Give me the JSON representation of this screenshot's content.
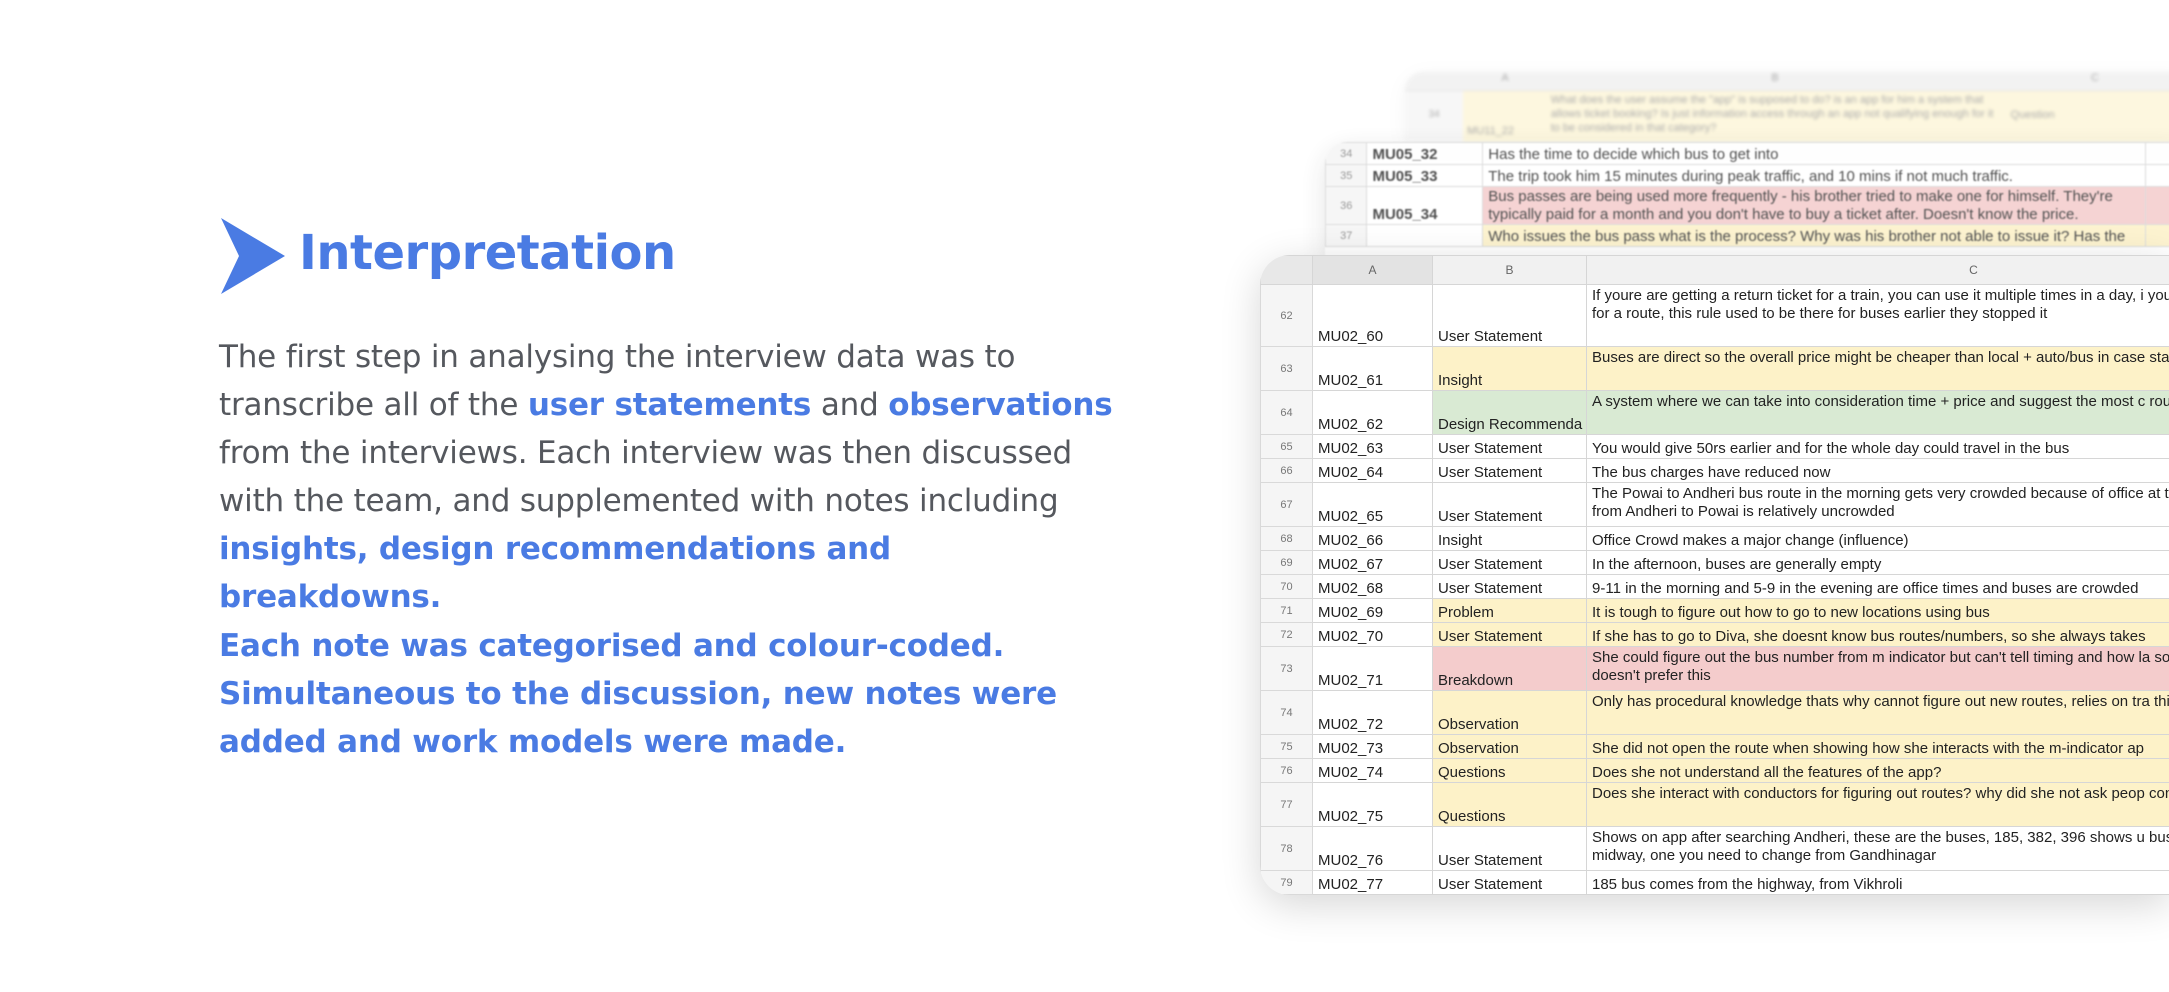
{
  "heading": {
    "title": "Interpretation",
    "accent_color": "#4a7be3",
    "icon": "play-arrow-icon"
  },
  "paragraph1": {
    "text_a": "The first step in analysing the interview data was to transcribe all of the ",
    "hl_user_statements": "user statements",
    "text_and": " and ",
    "hl_observations": "observations",
    "text_b": " from the interviews. Each interview was then discussed with the team, and supplemented with notes including ",
    "hl_insights": "insights, design recommendations and breakdowns."
  },
  "paragraph2": {
    "text": "Each note was categorised and colour-coded. Simultaneous to the discussion, new notes were added and work models were made."
  },
  "back_sheet_2": {
    "row_number": "34",
    "id": "MU11_22",
    "text": "What does the user assume the \"app\" is supposed to do? is an app for him a system that allows ticket booking? Is just information access through an app not qualifying enough for it to be considered in that category?",
    "category": "Question"
  },
  "back_sheet_1": {
    "rows": [
      {
        "row": "34",
        "id": "MU05_32",
        "text": "Has the time to decide which bus to get into",
        "color": ""
      },
      {
        "row": "35",
        "id": "MU05_33",
        "text": "The trip took him 15 minutes during peak traffic, and 10 mins if not much traffic.",
        "color": ""
      },
      {
        "row": "36",
        "id": "MU05_34",
        "text": "Bus passes are being used more frequently - his brother tried to make one for himself. They're typically paid for a month and you don't have to buy a ticket after. Doesn't know the price.",
        "color": "red"
      },
      {
        "row": "37",
        "id": "",
        "text": "Who issues the bus pass what is the process? Why was his brother not able to issue it? Has the",
        "color": "yellow"
      }
    ]
  },
  "main_sheet": {
    "columns": [
      "A",
      "B",
      "C"
    ],
    "colors": {
      "yellow": "#fdf2c8",
      "green": "#d9ead3",
      "red": "#f4cccc"
    },
    "rows": [
      {
        "row": "62",
        "id": "MU02_60",
        "category": "User Statement",
        "text": "If youre are getting a return ticket for a train, you can use it multiple times in a day, i you can only get a ticket once for a route, this rule used to be there for buses earlier they stopped it",
        "color": ""
      },
      {
        "row": "63",
        "id": "MU02_61",
        "category": "Insight",
        "text": "Buses are direct so the overall price might be cheaper than local + auto/bus in case station is far",
        "color": "yellow"
      },
      {
        "row": "64",
        "id": "MU02_62",
        "category": "Design Recommenda",
        "text": "A system where we can take into consideration time + price and suggest the most c route for travelling",
        "color": "green"
      },
      {
        "row": "65",
        "id": "MU02_63",
        "category": "User Statement",
        "text": "You would give 50rs earlier and for the whole day could travel in the bus",
        "color": ""
      },
      {
        "row": "66",
        "id": "MU02_64",
        "category": "User Statement",
        "text": "The bus charges have reduced now",
        "color": ""
      },
      {
        "row": "67",
        "id": "MU02_65",
        "category": "User Statement",
        "text": "The Powai to Andheri bus route in the morning gets very crowded because of office at the same time the route from Andheri to Powai is relatively uncrowded",
        "color": ""
      },
      {
        "row": "68",
        "id": "MU02_66",
        "category": "Insight",
        "text": "Office Crowd makes a major change (influence)",
        "color": ""
      },
      {
        "row": "69",
        "id": "MU02_67",
        "category": "User Statement",
        "text": "In the afternoon, buses are generally empty",
        "color": ""
      },
      {
        "row": "70",
        "id": "MU02_68",
        "category": "User Statement",
        "text": "9-11 in the morning and 5-9 in the evening are office times and buses are crowded",
        "color": ""
      },
      {
        "row": "71",
        "id": "MU02_69",
        "category": "Problem",
        "text": "It is tough to figure out how to go to new locations using bus",
        "color": "yellow"
      },
      {
        "row": "72",
        "id": "MU02_70",
        "category": "User Statement",
        "text": "If she has to go to Diva, she doesnt know bus routes/numbers, so she always takes",
        "color": "yellow"
      },
      {
        "row": "73",
        "id": "MU02_71",
        "category": "Breakdown",
        "text": "She could figure out the bus number from m indicator but can't tell timing and how la so she has to wait and doesn't prefer this",
        "color": "red"
      },
      {
        "row": "74",
        "id": "MU02_72",
        "category": "Observation",
        "text": "Only has procedural knowledge thats why cannot figure out new routes, relies on tra this case",
        "color": "yellow"
      },
      {
        "row": "75",
        "id": "MU02_73",
        "category": "Observation",
        "text": "She did not open the route when showing how she interacts with the m-indicator ap",
        "color": "yellow"
      },
      {
        "row": "76",
        "id": "MU02_74",
        "category": "Questions",
        "text": "Does she not understand all the features of the app?",
        "color": "yellow"
      },
      {
        "row": "77",
        "id": "MU02_75",
        "category": "Questions",
        "text": "Does she interact with conductors for figuring out routes? why did she not ask peop conductor about new route",
        "color": "yellow"
      },
      {
        "row": "78",
        "id": "MU02_76",
        "category": "User Statement",
        "text": "Shows on app after searching Andheri, these are the buses, 185, 382, 396 shows u buses you have to switch midway, one you need to change from Gandhinagar",
        "color": ""
      },
      {
        "row": "79",
        "id": "MU02_77",
        "category": "User Statement",
        "text": "185 bus comes from the highway, from Vikhroli",
        "color": ""
      }
    ]
  }
}
